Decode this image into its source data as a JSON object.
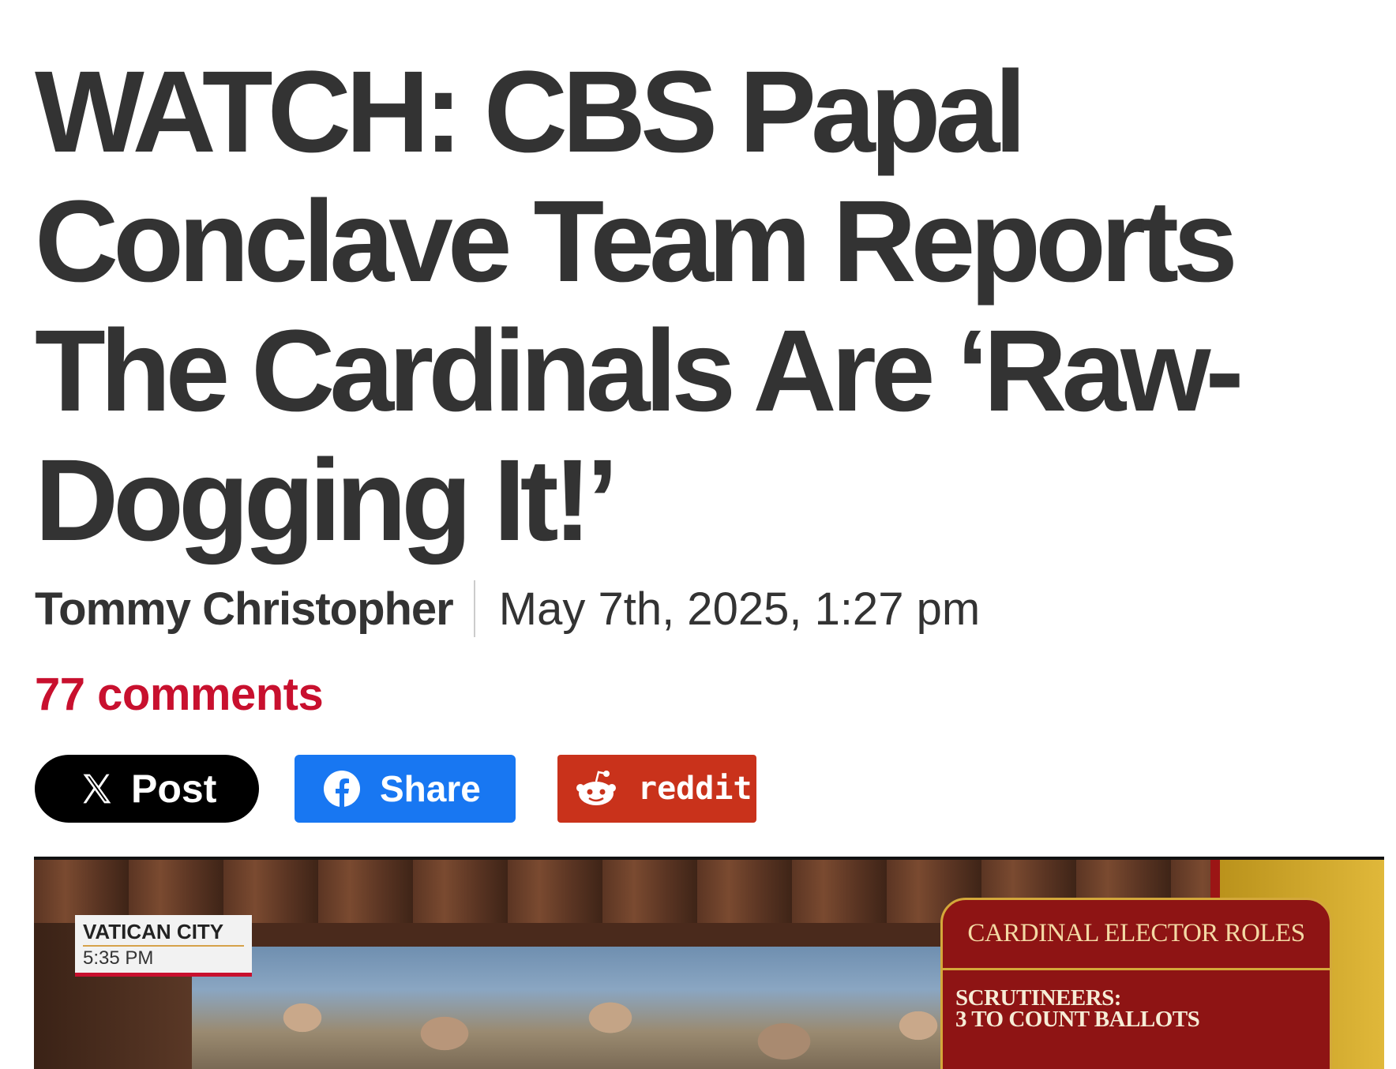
{
  "article": {
    "headline": "WATCH: CBS Papal Conclave Team Reports The Cardinals Are ‘Raw-Dogging It!’",
    "author": "Tommy Christopher",
    "date": "May 7th, 2025, 1:27 pm",
    "comments": "77 comments"
  },
  "share": {
    "x_label": "Post",
    "facebook_label": "Share",
    "reddit_label": "reddit"
  },
  "video": {
    "location": "VATICAN CITY",
    "time": "5:35 PM",
    "panel_title": "CARDINAL ELECTOR ROLES",
    "panel_line1": "SCRUTINEERS:",
    "panel_line2": "3 TO COUNT BALLOTS"
  },
  "colors": {
    "comments_accent": "#c8102e",
    "x_button": "#000000",
    "facebook_button": "#1877f2",
    "reddit_button": "#c9321b"
  }
}
